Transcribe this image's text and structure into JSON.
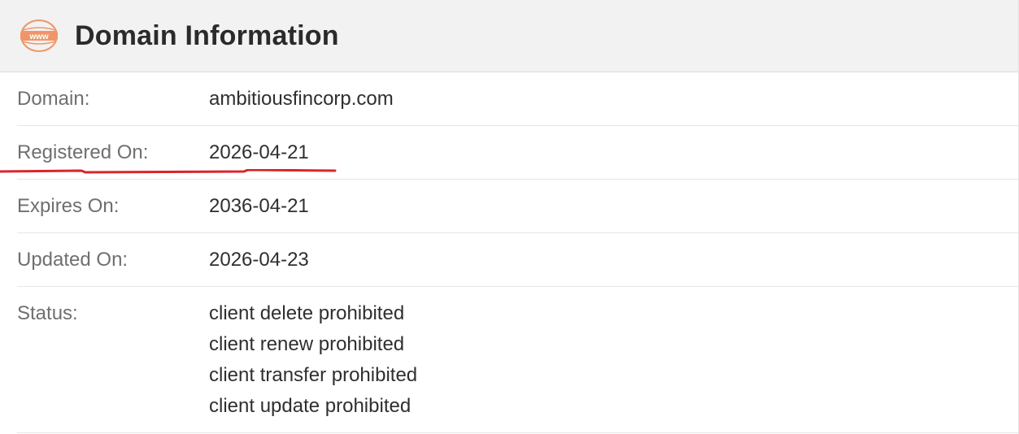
{
  "header": {
    "title": "Domain Information",
    "icon": "www-icon",
    "icon_text": "www",
    "icon_color": "#f0956a"
  },
  "fields": [
    {
      "label": "Domain:",
      "value": "ambitiousfincorp.com"
    },
    {
      "label": "Registered On:",
      "value": "2026-04-21"
    },
    {
      "label": "Expires On:",
      "value": "2036-04-21"
    },
    {
      "label": "Updated On:",
      "value": "2026-04-23"
    }
  ],
  "status": {
    "label": "Status:",
    "values": [
      "client delete prohibited",
      "client renew prohibited",
      "client transfer prohibited",
      "client update prohibited"
    ]
  },
  "annotation": {
    "type": "red-underline",
    "target": "Registered On",
    "color": "#d9252b"
  }
}
